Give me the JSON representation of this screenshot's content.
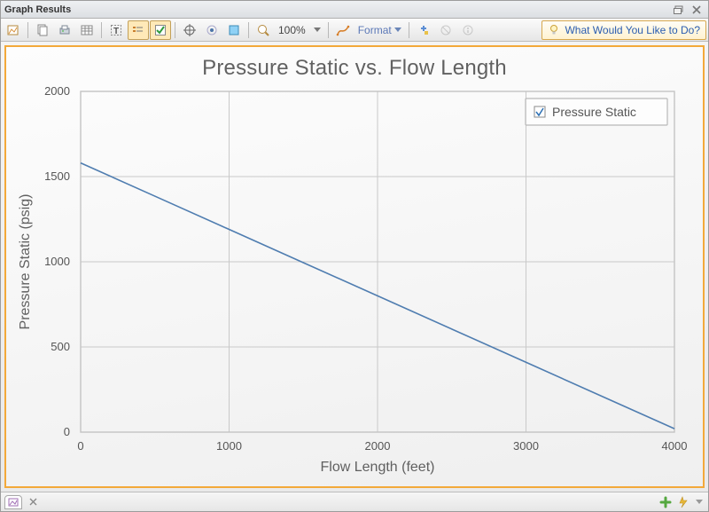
{
  "window": {
    "title": "Graph Results"
  },
  "toolbar": {
    "zoom": "100%",
    "format_label": "Format",
    "help_label": "What Would You Like to Do?"
  },
  "status": {},
  "chart_data": {
    "type": "line",
    "title": "Pressure Static vs. Flow Length",
    "xlabel": "Flow Length (feet)",
    "ylabel": "Pressure Static (psig)",
    "xlim": [
      0,
      4000
    ],
    "ylim": [
      0,
      2000
    ],
    "xticks": [
      0,
      1000,
      2000,
      3000,
      4000
    ],
    "yticks": [
      0,
      500,
      1000,
      1500,
      2000
    ],
    "legend": {
      "position": "top-right",
      "items": [
        "Pressure Static"
      ],
      "checked": [
        true
      ]
    },
    "series": [
      {
        "name": "Pressure Static",
        "x": [
          0,
          500,
          1000,
          1500,
          2000,
          2500,
          3000,
          3500,
          4000
        ],
        "values": [
          1580,
          1385,
          1190,
          995,
          800,
          605,
          410,
          215,
          20
        ]
      }
    ]
  }
}
